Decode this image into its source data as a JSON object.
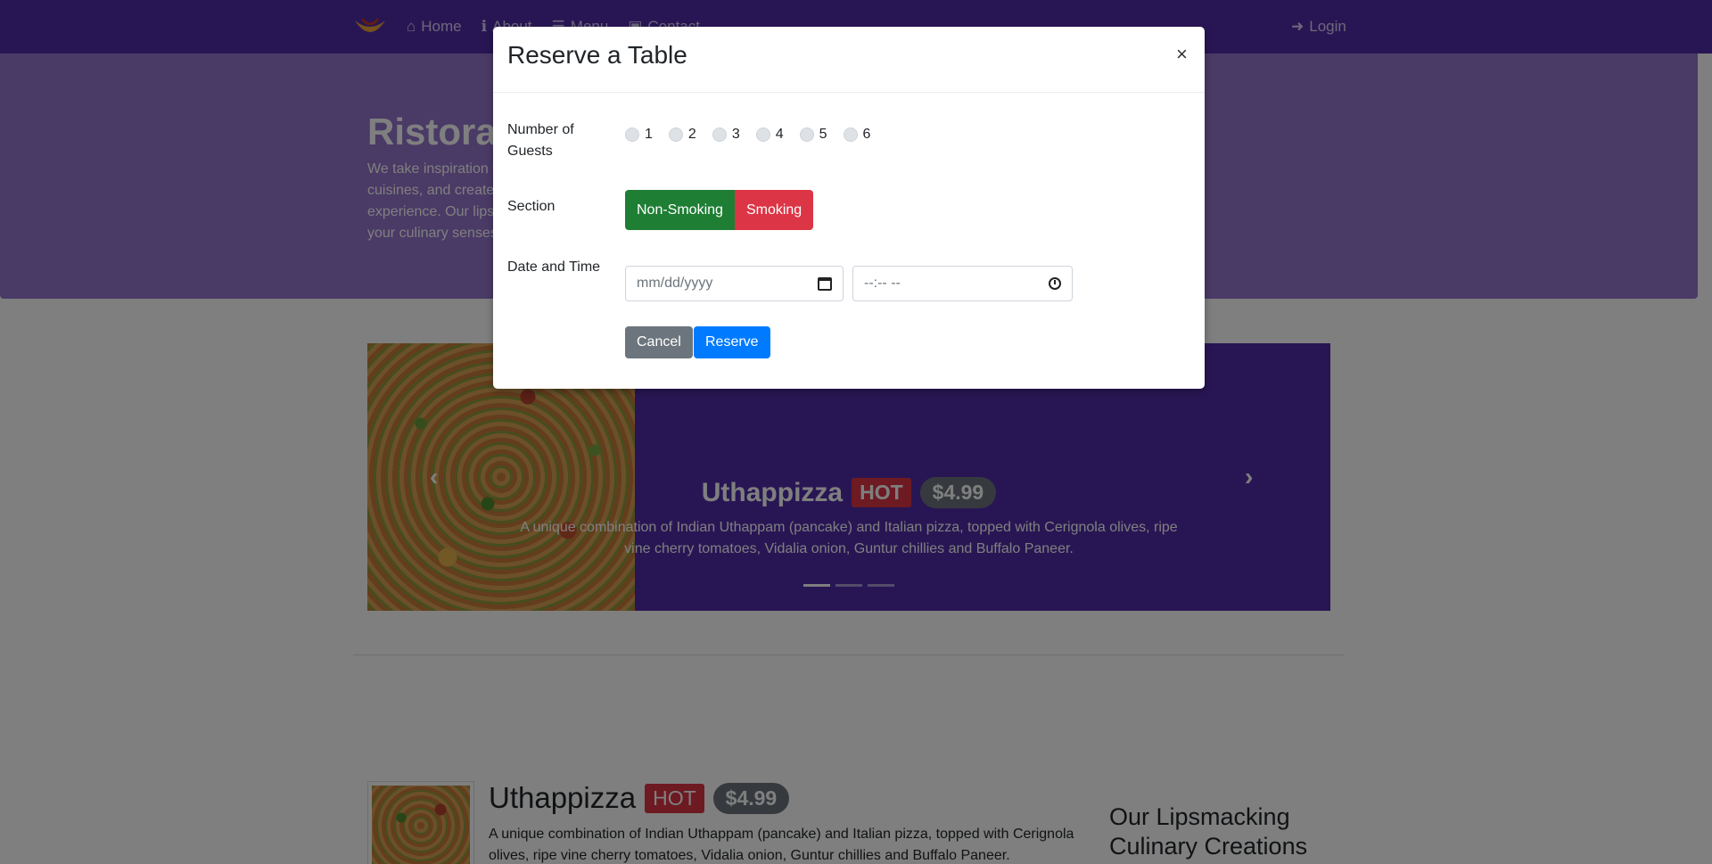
{
  "navbar": {
    "items": [
      {
        "label": "Home",
        "icon": "home-icon"
      },
      {
        "label": "About",
        "icon": "info-icon"
      },
      {
        "label": "Menu",
        "icon": "list-icon"
      },
      {
        "label": "Contact",
        "icon": "address-card-icon"
      }
    ],
    "login_label": "Login"
  },
  "jumbotron": {
    "title": "Ristorante con Fusion",
    "text": "We take inspiration from the World's best cuisines, and create a unique fusion experience. Our lipsmacking creations will tickle your culinary senses!"
  },
  "carousel": {
    "title": "Uthappizza",
    "badge": "HOT",
    "price": "$4.99",
    "description": "A unique combination of Indian Uthappam (pancake) and Italian pizza, topped with Cerignola olives, ripe vine cherry tomatoes, Vidalia onion, Guntur chillies and Buffalo Paneer.",
    "next_symbol": "›",
    "prev_symbol": "‹"
  },
  "media": {
    "title": "Uthappizza",
    "badge": "HOT",
    "price": "$4.99",
    "description": "A unique combination of Indian Uthappam (pancake) and Italian pizza, topped with Cerignola olives, ripe vine cherry tomatoes, Vidalia onion, Guntur chillies and Buffalo Paneer."
  },
  "side": {
    "title": "Our Lipsmacking Culinary Creations"
  },
  "modal": {
    "title": "Reserve a Table",
    "close": "×",
    "guests_label": "Number of Guests",
    "guest_options": [
      "1",
      "2",
      "3",
      "4",
      "5",
      "6"
    ],
    "section_label": "Section",
    "non_smoking": "Non-Smoking",
    "smoking": "Smoking",
    "datetime_label": "Date and Time",
    "date_placeholder": "mm/dd/yyyy",
    "time_placeholder": "--:-- --",
    "cancel": "Cancel",
    "reserve": "Reserve"
  },
  "colors": {
    "navbar": "#512DA8",
    "jumbotron": "#9575CD",
    "success": "#1e7e34",
    "danger": "#dc3545",
    "primary": "#007bff",
    "secondary": "#6c757d"
  }
}
